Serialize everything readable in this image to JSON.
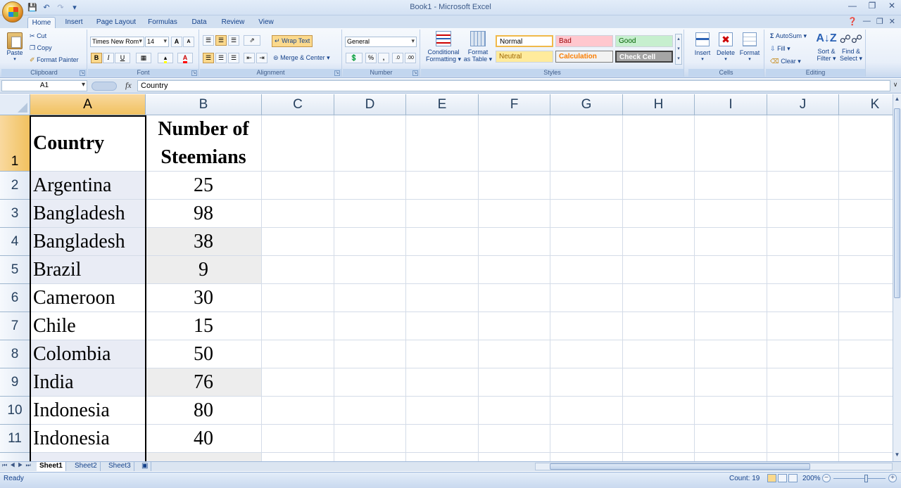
{
  "app": {
    "title": "Book1 - Microsoft Excel"
  },
  "ribbon_tabs": [
    "Home",
    "Insert",
    "Page Layout",
    "Formulas",
    "Data",
    "Review",
    "View"
  ],
  "clipboard": {
    "paste": "Paste",
    "cut": "Cut",
    "copy": "Copy",
    "format_painter": "Format Painter",
    "label": "Clipboard"
  },
  "font": {
    "name": "Times New Rom",
    "size": "14",
    "bold": "B",
    "italic": "I",
    "underline": "U",
    "grow": "A",
    "shrink": "A",
    "font_color": "A",
    "label": "Font"
  },
  "alignment": {
    "wrap_text": "Wrap Text",
    "merge_center": "Merge & Center",
    "label": "Alignment"
  },
  "number": {
    "format": "General",
    "percent": "%",
    "comma": ",",
    "label": "Number"
  },
  "styles": {
    "conditional_formatting_1": "Conditional",
    "conditional_formatting_2": "Formatting",
    "format_table_1": "Format",
    "format_table_2": "as Table",
    "normal": "Normal",
    "bad": "Bad",
    "good": "Good",
    "neutral": "Neutral",
    "calculation": "Calculation",
    "check_cell": "Check Cell",
    "label": "Styles",
    "colors": {
      "normal_bg": "#ffffff",
      "bad_bg": "#ffc7ce",
      "bad_fg": "#9c0006",
      "good_bg": "#c6efce",
      "good_fg": "#006100",
      "neutral_bg": "#ffeb9c",
      "neutral_fg": "#9c6500",
      "calc_bg": "#f2f2f2",
      "calc_fg": "#fa7d00",
      "check_bg": "#a5a5a5",
      "check_fg": "#ffffff"
    }
  },
  "cells_group": {
    "insert": "Insert",
    "delete": "Delete",
    "format": "Format",
    "label": "Cells"
  },
  "editing": {
    "autosum": "AutoSum",
    "fill": "Fill",
    "clear": "Clear",
    "sort_filter_1": "Sort &",
    "sort_filter_2": "Filter",
    "find_select_1": "Find &",
    "find_select_2": "Select",
    "label": "Editing"
  },
  "formula_bar": {
    "name_box": "A1",
    "fx": "fx",
    "value": "Country"
  },
  "columns": [
    "A",
    "B",
    "C",
    "D",
    "E",
    "F",
    "G",
    "H",
    "I",
    "J",
    "K"
  ],
  "rows": [
    {
      "num": "1",
      "a": "Country",
      "b_line1": "Number of",
      "b_line2": "Steemians"
    },
    {
      "num": "2",
      "a": "Argentina",
      "b": "25"
    },
    {
      "num": "3",
      "a": "Bangladesh",
      "b": "98"
    },
    {
      "num": "4",
      "a": "Bangladesh",
      "b": "38"
    },
    {
      "num": "5",
      "a": "Brazil",
      "b": "9"
    },
    {
      "num": "6",
      "a": "Cameroon",
      "b": "30"
    },
    {
      "num": "7",
      "a": "Chile",
      "b": "15"
    },
    {
      "num": "8",
      "a": "Colombia",
      "b": "50"
    },
    {
      "num": "9",
      "a": "India",
      "b": "76"
    },
    {
      "num": "10",
      "a": "Indonesia",
      "b": "80"
    },
    {
      "num": "11",
      "a": "Indonesia",
      "b": "40"
    }
  ],
  "sheets": [
    "Sheet1",
    "Sheet2",
    "Sheet3"
  ],
  "status": {
    "ready": "Ready",
    "count": "Count: 19",
    "zoom": "200%"
  }
}
